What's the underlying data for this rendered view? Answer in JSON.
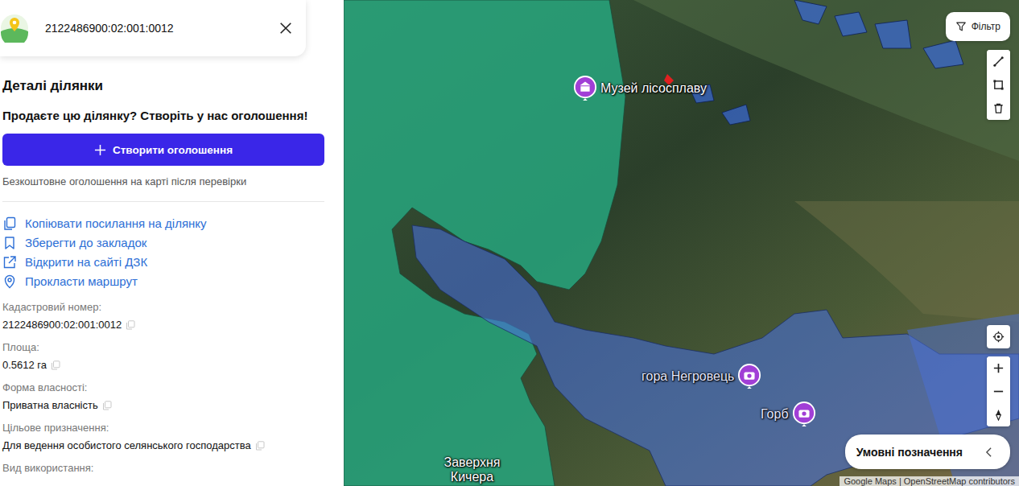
{
  "search": {
    "value": "2122486900:02:001:0012"
  },
  "panel": {
    "title": "Деталі ділянки",
    "promo": "Продаєте цю ділянку? Створіть у нас оголошення!",
    "button": "Створити оголошення",
    "note": "Безкоштовне оголошення на карті після перевірки"
  },
  "actions": [
    {
      "label": "Копіювати посилання на ділянку",
      "kind": "copy"
    },
    {
      "label": "Зберегти до закладок",
      "kind": "bookmark"
    },
    {
      "label": "Відкрити на сайті ДЗК",
      "kind": "external"
    },
    {
      "label": "Прокласти маршрут",
      "kind": "route"
    }
  ],
  "fields": [
    {
      "label": "Кадастровий номер:",
      "value": "2122486900:02:001:0012"
    },
    {
      "label": "Площа:",
      "value": "0.5612 га"
    },
    {
      "label": "Форма власності:",
      "value": "Приватна власність"
    },
    {
      "label": "Цільове призначення:",
      "value": "Для ведення особистого селянського господарства"
    },
    {
      "label": "Вид використання:"
    }
  ],
  "map": {
    "filter": "Фільтр",
    "legend": "Умовні позначення",
    "attribution": "Google Maps | OpenStreetMap contributors",
    "places": [
      {
        "name": "Музей лісосплаву",
        "kind": "museum"
      },
      {
        "name": "гора Негровець",
        "kind": "peak"
      },
      {
        "name": "Горб",
        "kind": "peak"
      },
      {
        "name": "Заверхня Кичера",
        "kind": "village"
      }
    ]
  }
}
